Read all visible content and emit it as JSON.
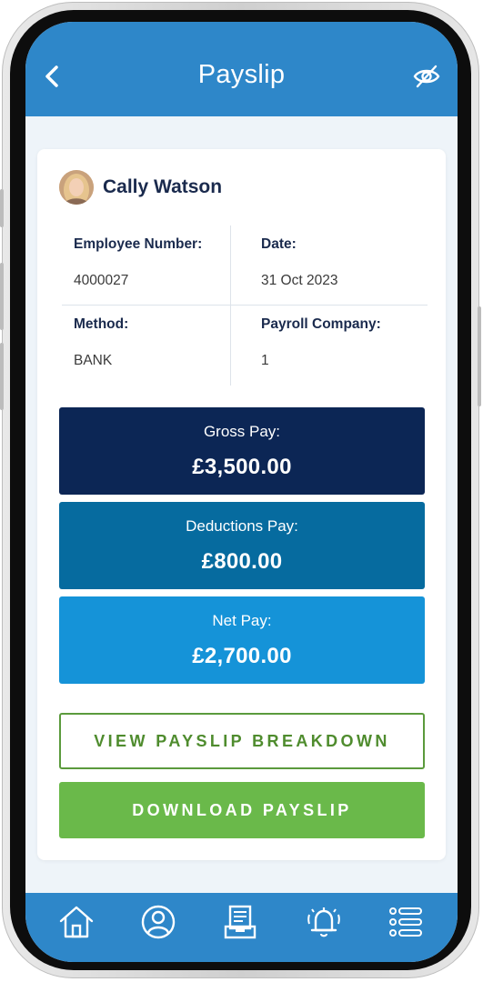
{
  "header": {
    "title": "Payslip",
    "back_icon": "chevron-left-icon",
    "visibility_icon": "eye-off-icon",
    "background": "#2e87c9"
  },
  "employee": {
    "name": "Cally Watson",
    "avatar_icon": "avatar"
  },
  "details": {
    "employee_number_label": "Employee Number:",
    "employee_number": "4000027",
    "date_label": "Date:",
    "date": "31 Oct 2023",
    "method_label": "Method:",
    "method": "BANK",
    "payroll_company_label": "Payroll Company:",
    "payroll_company": "1"
  },
  "pay": {
    "gross_label": "Gross Pay:",
    "gross_amount": "£3,500.00",
    "gross_color": "#0c2655",
    "deductions_label": "Deductions Pay:",
    "deductions_amount": "£800.00",
    "deductions_color": "#066b9f",
    "net_label": "Net Pay:",
    "net_amount": "£2,700.00",
    "net_color": "#1593d8"
  },
  "actions": {
    "view_breakdown": "VIEW PAYSLIP BREAKDOWN",
    "download": "DOWNLOAD PAYSLIP",
    "accent_green": "#6ab94a"
  },
  "tabbar": {
    "items": [
      {
        "icon": "home-icon"
      },
      {
        "icon": "profile-icon"
      },
      {
        "icon": "payslip-icon"
      },
      {
        "icon": "notification-bell-icon"
      },
      {
        "icon": "menu-list-icon"
      }
    ]
  }
}
